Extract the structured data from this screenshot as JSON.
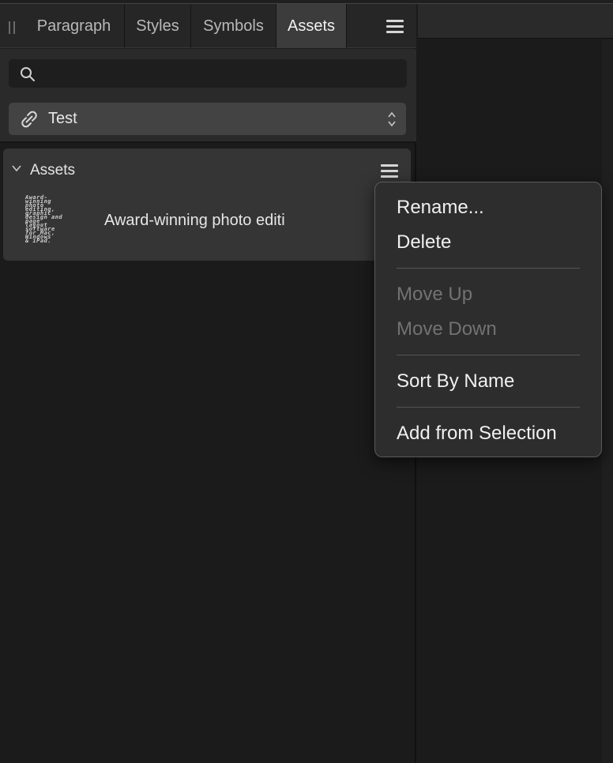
{
  "tabs": [
    {
      "label": "Paragraph",
      "active": false
    },
    {
      "label": "Styles",
      "active": false
    },
    {
      "label": "Symbols",
      "active": false
    },
    {
      "label": "Assets",
      "active": true
    }
  ],
  "search": {
    "placeholder": "",
    "value": ""
  },
  "category": {
    "selected": "Test",
    "icon": "link-icon"
  },
  "section": {
    "title": "Assets",
    "asset": {
      "label": "Award-winning photo editi",
      "thumbnail_lines": [
        "Award-",
        "winning",
        "photo",
        "editing,",
        "graphic",
        "design and",
        "page",
        "layout",
        "software",
        "for Mac,",
        "Windows",
        "& iPad."
      ]
    }
  },
  "context_menu": {
    "items": [
      {
        "label": "Rename...",
        "enabled": true
      },
      {
        "label": "Delete",
        "enabled": true
      },
      {
        "label": "Move Up",
        "enabled": false
      },
      {
        "label": "Move Down",
        "enabled": false
      },
      {
        "label": "Sort By Name",
        "enabled": true
      },
      {
        "label": "Add from Selection",
        "enabled": true
      }
    ]
  },
  "colors": {
    "background": "#1b1b1b",
    "active_tab": "#3c3c3c",
    "menu_background": "#2d2d2d",
    "disabled_text": "#727272"
  }
}
